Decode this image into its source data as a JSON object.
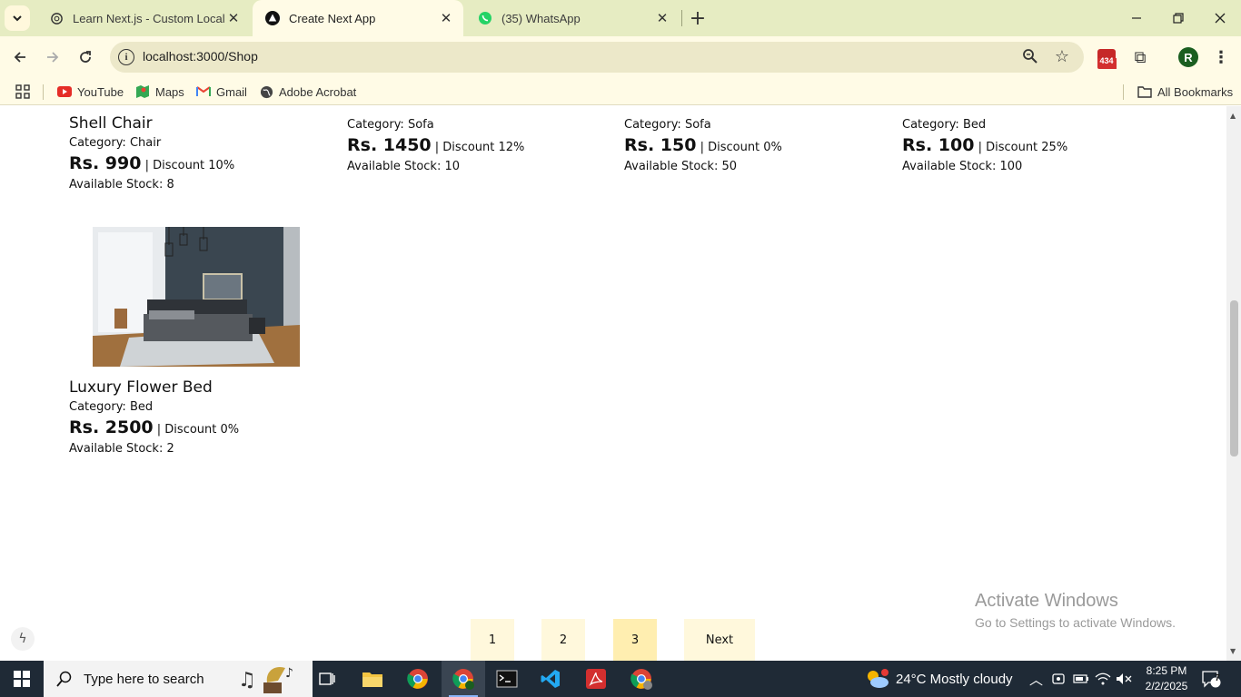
{
  "browser": {
    "tabs": [
      {
        "title": "Learn Next.js - Custom Localho",
        "icon": "openai-icon",
        "active": false
      },
      {
        "title": "Create Next App",
        "icon": "nextjs-icon",
        "active": true
      },
      {
        "title": "(35) WhatsApp",
        "icon": "whatsapp-icon",
        "active": false
      }
    ],
    "url": "localhost:3000/Shop",
    "extension_badge": "434",
    "profile_initial": "R",
    "bookmarks": [
      "YouTube",
      "Maps",
      "Gmail",
      "Adobe Acrobat"
    ],
    "all_bookmarks": "All Bookmarks"
  },
  "products_top_row": [
    {
      "name": "Shell Chair",
      "category": "Category: Chair",
      "price": "Rs. 990",
      "discount": " | Discount 10%",
      "stock": "Available Stock: 8"
    },
    {
      "category": "Category: Sofa",
      "price": "Rs. 1450",
      "discount": " | Discount 12%",
      "stock": "Available Stock: 10"
    },
    {
      "category": "Category: Sofa",
      "price": "Rs. 150",
      "discount": " | Discount 0%",
      "stock": "Available Stock: 50"
    },
    {
      "category": "Category: Bed",
      "price": "Rs. 100",
      "discount": " | Discount 25%",
      "stock": "Available Stock: 100"
    }
  ],
  "product_featured": {
    "name": "Luxury Flower Bed",
    "category": "Category: Bed",
    "price": "Rs. 2500",
    "discount": " | Discount 0%",
    "stock": "Available Stock: 2"
  },
  "pagination": {
    "pages": [
      "1",
      "2",
      "3"
    ],
    "current": "3",
    "next": "Next"
  },
  "watermark": {
    "title": "Activate Windows",
    "subtitle": "Go to Settings to activate Windows."
  },
  "taskbar": {
    "search_placeholder": "Type here to search",
    "weather": "24°C  Mostly cloudy",
    "time": "8:25 PM",
    "date": "2/2/2025",
    "notifications": "7"
  },
  "colors": {
    "chrome_bg": "#e6ecc2",
    "toolbar_bg": "#fffbe6",
    "pager_bg": "#fff8dc",
    "pager_active_bg": "#ffeeb0",
    "taskbar_bg": "#1f2a36"
  }
}
